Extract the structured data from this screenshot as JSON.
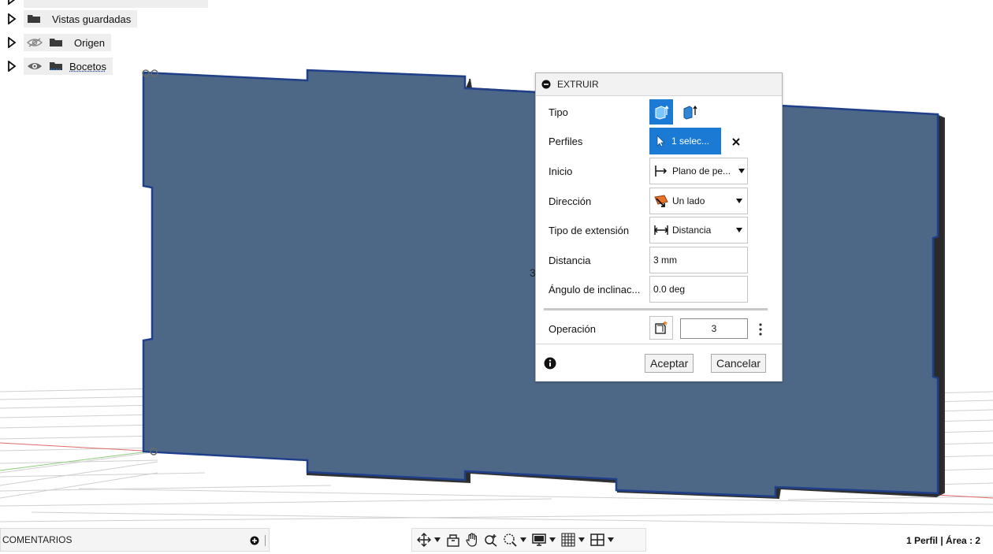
{
  "browser": {
    "items": [
      {
        "label": "Vistas guardadas"
      },
      {
        "label": "Origen"
      },
      {
        "label": "Bocetos"
      }
    ]
  },
  "viewport": {
    "dimension_label": "3"
  },
  "extrude": {
    "title": "EXTRUIR",
    "rows": {
      "tipo": {
        "label": "Tipo"
      },
      "perfiles": {
        "label": "Perfiles",
        "value": "1 selec..."
      },
      "inicio": {
        "label": "Inicio",
        "value": "Plano de pe..."
      },
      "direccion": {
        "label": "Dirección",
        "value": "Un lado"
      },
      "tipo_extension": {
        "label": "Tipo de extensión",
        "value": "Distancia"
      },
      "distancia": {
        "label": "Distancia",
        "value": "3 mm"
      },
      "angulo": {
        "label": "Ángulo de inclinac...",
        "value": "0.0 deg"
      },
      "operacion": {
        "label": "Operación",
        "value": "3"
      }
    },
    "accept": "Aceptar",
    "cancel": "Cancelar"
  },
  "bottom": {
    "comments": "COMENTARIOS",
    "status": "1 Perfil | Área : 2"
  },
  "colors": {
    "plate": "#4d6886",
    "accent": "#1b7bd4",
    "edge": "#1f3f8a"
  }
}
